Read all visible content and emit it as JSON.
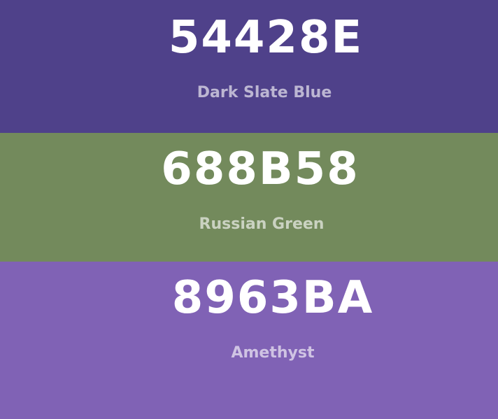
{
  "swatches": [
    {
      "hex": "54428E",
      "name": "Dark Slate Blue",
      "color": "#4F418A"
    },
    {
      "hex": "688B58",
      "name": "Russian Green",
      "color": "#738A5C"
    },
    {
      "hex": "8963BA",
      "name": "Amethyst",
      "color": "#8062B5"
    }
  ]
}
